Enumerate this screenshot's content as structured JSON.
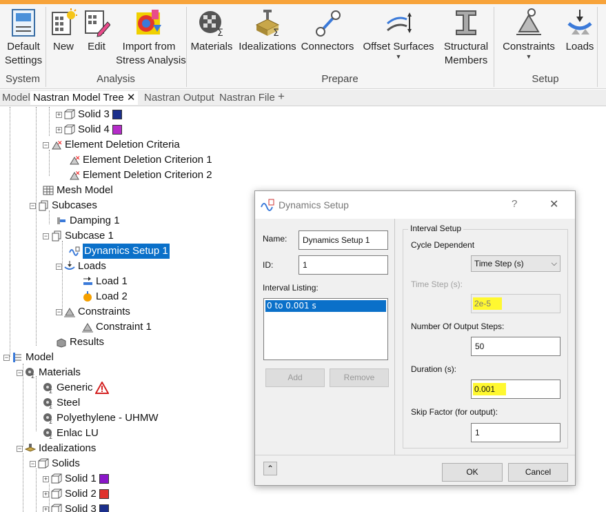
{
  "ribbon": {
    "buttons": [
      {
        "label": "Default\nSettings",
        "icon": "default-settings-icon"
      },
      {
        "label": "New",
        "icon": "new-icon"
      },
      {
        "label": "Edit",
        "icon": "edit-icon"
      },
      {
        "label": "Import from\nStress Analysis",
        "icon": "import-stress-icon"
      },
      {
        "label": "Materials",
        "icon": "materials-icon"
      },
      {
        "label": "Idealizations",
        "icon": "idealizations-icon"
      },
      {
        "label": "Connectors",
        "icon": "connectors-icon"
      },
      {
        "label": "Offset Surfaces",
        "icon": "offset-surfaces-icon"
      },
      {
        "label": "Structural\nMembers",
        "icon": "structural-members-icon"
      },
      {
        "label": "Constraints",
        "icon": "constraints-icon"
      },
      {
        "label": "Loads",
        "icon": "loads-icon"
      }
    ],
    "groups": [
      "System",
      "Analysis",
      "Prepare",
      "Setup"
    ]
  },
  "tabs": [
    {
      "label": "Model"
    },
    {
      "label": "Nastran Model Tree"
    },
    {
      "label": "Nastran Output"
    },
    {
      "label": "Nastran File"
    }
  ],
  "tab_close": "✕",
  "tab_add": "+",
  "tree": [
    {
      "label": "Solid 3",
      "swatch": "#1b2f8c",
      "exp": "+"
    },
    {
      "label": "Solid 4",
      "swatch": "#b52cc9",
      "exp": "+"
    },
    {
      "label": "Element Deletion Criteria",
      "exp": "−"
    },
    {
      "label": "Element Deletion Criterion 1"
    },
    {
      "label": "Element Deletion Criterion 2"
    },
    {
      "label": "Mesh Model"
    },
    {
      "label": "Subcases",
      "exp": "−"
    },
    {
      "label": "Damping 1"
    },
    {
      "label": "Subcase 1",
      "exp": "−"
    },
    {
      "label": "Dynamics Setup 1",
      "selected": true
    },
    {
      "label": "Loads",
      "exp": "−"
    },
    {
      "label": "Load 1"
    },
    {
      "label": "Load 2"
    },
    {
      "label": "Constraints",
      "exp": "−"
    },
    {
      "label": "Constraint 1"
    },
    {
      "label": "Results"
    },
    {
      "label": "Model",
      "exp": "−"
    },
    {
      "label": "Materials",
      "exp": "−"
    },
    {
      "label": "Generic",
      "warning": true
    },
    {
      "label": "Steel"
    },
    {
      "label": "Polyethylene - UHMW"
    },
    {
      "label": "Enlac LU"
    },
    {
      "label": "Idealizations",
      "exp": "−"
    },
    {
      "label": "Solids",
      "exp": "−"
    },
    {
      "label": "Solid 1",
      "swatch": "#8a16c9",
      "exp": "+"
    },
    {
      "label": "Solid 2",
      "swatch": "#e0332c",
      "exp": "+"
    },
    {
      "label": "Solid 3",
      "swatch": "#1b2f8c",
      "exp": "+"
    }
  ],
  "dialog": {
    "title": "Dynamics Setup",
    "help": "?",
    "close": "✕",
    "name_label": "Name:",
    "name_value": "Dynamics Setup 1",
    "id_label": "ID:",
    "id_value": "1",
    "interval_listing_label": "Interval Listing:",
    "interval_items": [
      "0 to 0.001 s"
    ],
    "add_label": "Add",
    "remove_label": "Remove",
    "interval_setup_label": "Interval Setup",
    "cycle_dependent_label": "Cycle Dependent",
    "cycle_dependent_value": "Time Step (s)",
    "time_step_label": "Time Step (s):",
    "time_step_value": "2e-5",
    "output_steps_label": "Number Of Output Steps:",
    "output_steps_value": "50",
    "duration_label": "Duration (s):",
    "duration_value": "0.001",
    "skip_factor_label": "Skip Factor (for output):",
    "skip_factor_value": "1",
    "expand_label": "⌃",
    "ok_label": "OK",
    "cancel_label": "Cancel"
  }
}
